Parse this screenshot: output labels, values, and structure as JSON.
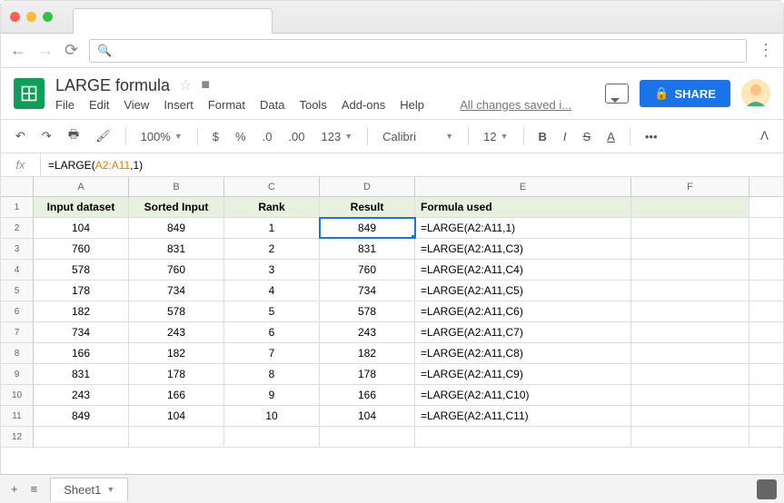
{
  "doc_title": "LARGE formula",
  "menus": [
    "File",
    "Edit",
    "View",
    "Insert",
    "Format",
    "Data",
    "Tools",
    "Add-ons",
    "Help"
  ],
  "save_status": "All changes saved i...",
  "share_label": "SHARE",
  "toolbar": {
    "zoom": "100%",
    "font": "Calibri",
    "size": "12",
    "num_fmt": "123"
  },
  "formula_bar": {
    "prefix": "=LARGE(",
    "range": "A2:A11",
    "suffix": ",1)"
  },
  "columns": [
    "A",
    "B",
    "C",
    "D",
    "E",
    "F"
  ],
  "header_row": [
    "Input dataset",
    "Sorted Input",
    "Rank",
    "Result",
    "Formula used",
    ""
  ],
  "rows": [
    {
      "n": 2,
      "a": "104",
      "b": "849",
      "c": "1",
      "d": "849",
      "e": "=LARGE(A2:A11,1)"
    },
    {
      "n": 3,
      "a": "760",
      "b": "831",
      "c": "2",
      "d": "831",
      "e": "=LARGE(A2:A11,C3)"
    },
    {
      "n": 4,
      "a": "578",
      "b": "760",
      "c": "3",
      "d": "760",
      "e": "=LARGE(A2:A11,C4)"
    },
    {
      "n": 5,
      "a": "178",
      "b": "734",
      "c": "4",
      "d": "734",
      "e": "=LARGE(A2:A11,C5)"
    },
    {
      "n": 6,
      "a": "182",
      "b": "578",
      "c": "5",
      "d": "578",
      "e": "=LARGE(A2:A11,C6)"
    },
    {
      "n": 7,
      "a": "734",
      "b": "243",
      "c": "6",
      "d": "243",
      "e": "=LARGE(A2:A11,C7)"
    },
    {
      "n": 8,
      "a": "166",
      "b": "182",
      "c": "7",
      "d": "182",
      "e": "=LARGE(A2:A11,C8)"
    },
    {
      "n": 9,
      "a": "831",
      "b": "178",
      "c": "8",
      "d": "178",
      "e": "=LARGE(A2:A11,C9)"
    },
    {
      "n": 10,
      "a": "243",
      "b": "166",
      "c": "9",
      "d": "166",
      "e": "=LARGE(A2:A11,C10)"
    },
    {
      "n": 11,
      "a": "849",
      "b": "104",
      "c": "10",
      "d": "104",
      "e": "=LARGE(A2:A11,C11)"
    }
  ],
  "sheet_name": "Sheet1",
  "selected_cell": "D2"
}
